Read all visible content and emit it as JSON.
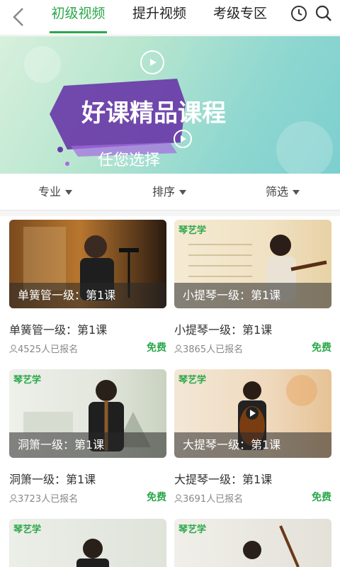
{
  "nav": {
    "tabs": [
      {
        "label": "初级视频"
      },
      {
        "label": "提升视频"
      },
      {
        "label": "考级专区"
      }
    ],
    "back_icon": "chevron-left-icon",
    "history_icon": "clock-icon",
    "search_icon": "search-icon",
    "accent_color": "#2aa84a"
  },
  "banner": {
    "headline": "好课精品课程",
    "subline": "任您选择"
  },
  "filters": [
    {
      "label": "专业"
    },
    {
      "label": "排序"
    },
    {
      "label": "筛选"
    }
  ],
  "courses": [
    {
      "overlay": "单簧管一级：第1课",
      "title": "单簧管一级：第1课",
      "enrolled": "4525人已报名",
      "price": "免费"
    },
    {
      "overlay": "小提琴一级：第1课",
      "title": "小提琴一级：第1课",
      "enrolled": "3865人已报名",
      "price": "免费"
    },
    {
      "overlay": "洞箫一级：第1课",
      "title": "洞箫一级：第1课",
      "enrolled": "3723人已报名",
      "price": "免费"
    },
    {
      "overlay": "大提琴一级：第1课",
      "title": "大提琴一级：第1课",
      "enrolled": "3691人已报名",
      "price": "免费"
    }
  ],
  "brand_label": "琴艺学"
}
